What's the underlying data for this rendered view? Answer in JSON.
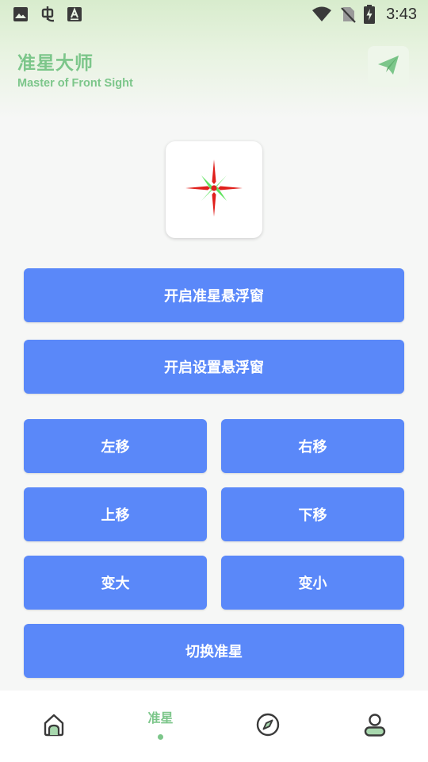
{
  "status_bar": {
    "time": "3:43",
    "left_icons": [
      "image-icon",
      "bug-icon",
      "font-icon"
    ],
    "right_icons": [
      "wifi-icon",
      "no-sim-icon",
      "battery-charging-icon"
    ]
  },
  "header": {
    "title": "准星大师",
    "subtitle": "Master of Front Sight",
    "action_icon": "send-icon"
  },
  "preview": {
    "icon": "crosshair-icon",
    "colors": {
      "arms": "#e0201c",
      "diagonals": "#5fe35f",
      "center": "#e0201c"
    }
  },
  "buttons": {
    "open_crosshair_float": "开启准星悬浮窗",
    "open_settings_float": "开启设置悬浮窗",
    "move_left": "左移",
    "move_right": "右移",
    "move_up": "上移",
    "move_down": "下移",
    "enlarge": "变大",
    "shrink": "变小",
    "switch_crosshair": "切换准星"
  },
  "bottom_nav": {
    "items": [
      {
        "icon": "home-icon",
        "label": ""
      },
      {
        "icon": "",
        "label": "准星",
        "active": true
      },
      {
        "icon": "compass-icon",
        "label": ""
      },
      {
        "icon": "profile-icon",
        "label": ""
      }
    ]
  },
  "colors": {
    "accent_green": "#7cc68a",
    "button_blue": "#5a88f9",
    "background": "#f6f7f6"
  }
}
